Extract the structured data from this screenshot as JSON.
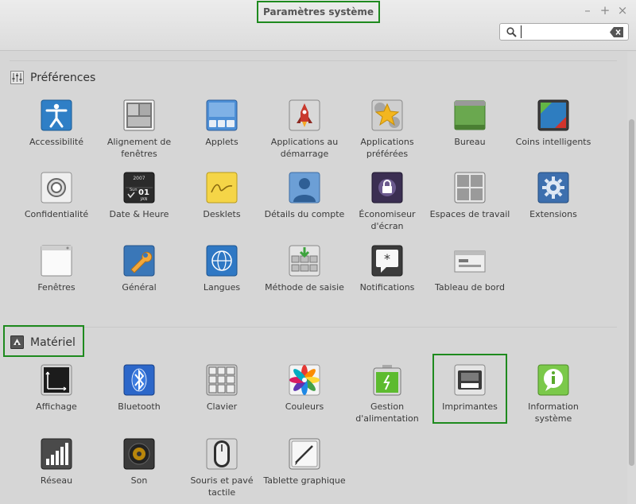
{
  "window": {
    "title": "Paramètres système",
    "controls": [
      "–",
      "+",
      "×"
    ]
  },
  "search": {
    "value": "",
    "placeholder": ""
  },
  "sections": {
    "preferences": {
      "title": "Préférences",
      "items": [
        {
          "label": "Accessibilité",
          "icon": "accessibility-icon"
        },
        {
          "label": "Alignement de fenêtres",
          "icon": "window-tiling-icon"
        },
        {
          "label": "Applets",
          "icon": "applets-icon"
        },
        {
          "label": "Applications au démarrage",
          "icon": "startup-applications-icon"
        },
        {
          "label": "Applications préférées",
          "icon": "preferred-applications-icon"
        },
        {
          "label": "Bureau",
          "icon": "desktop-icon"
        },
        {
          "label": "Coins intelligents",
          "icon": "hot-corners-icon"
        },
        {
          "label": "Confidentialité",
          "icon": "privacy-icon"
        },
        {
          "label": "Date & Heure",
          "icon": "date-time-icon"
        },
        {
          "label": "Desklets",
          "icon": "desklets-icon"
        },
        {
          "label": "Détails du compte",
          "icon": "account-icon"
        },
        {
          "label": "Économiseur d'écran",
          "icon": "screensaver-icon"
        },
        {
          "label": "Espaces de travail",
          "icon": "workspaces-icon"
        },
        {
          "label": "Extensions",
          "icon": "extensions-icon"
        },
        {
          "label": "Fenêtres",
          "icon": "windows-icon"
        },
        {
          "label": "Général",
          "icon": "general-icon"
        },
        {
          "label": "Langues",
          "icon": "languages-icon"
        },
        {
          "label": "Méthode de saisie",
          "icon": "input-method-icon"
        },
        {
          "label": "Notifications",
          "icon": "notifications-icon"
        },
        {
          "label": "Tableau de bord",
          "icon": "panel-icon"
        }
      ]
    },
    "hardware": {
      "title": "Matériel",
      "items": [
        {
          "label": "Affichage",
          "icon": "display-icon"
        },
        {
          "label": "Bluetooth",
          "icon": "bluetooth-icon"
        },
        {
          "label": "Clavier",
          "icon": "keyboard-icon"
        },
        {
          "label": "Couleurs",
          "icon": "color-icon"
        },
        {
          "label": "Gestion d'alimentation",
          "icon": "power-icon"
        },
        {
          "label": "Imprimantes",
          "icon": "printer-icon"
        },
        {
          "label": "Information système",
          "icon": "system-info-icon"
        },
        {
          "label": "Réseau",
          "icon": "network-icon"
        },
        {
          "label": "Son",
          "icon": "sound-icon"
        },
        {
          "label": "Souris et pavé tactile",
          "icon": "mouse-icon"
        },
        {
          "label": "Tablette graphique",
          "icon": "tablet-icon"
        }
      ]
    }
  },
  "date_icon_text": {
    "year": "2007",
    "month": "JAN",
    "day": "01",
    "dayname": "Sun"
  },
  "colors": {
    "highlight": "#1e8a1e",
    "background": "#d6d6d6"
  }
}
